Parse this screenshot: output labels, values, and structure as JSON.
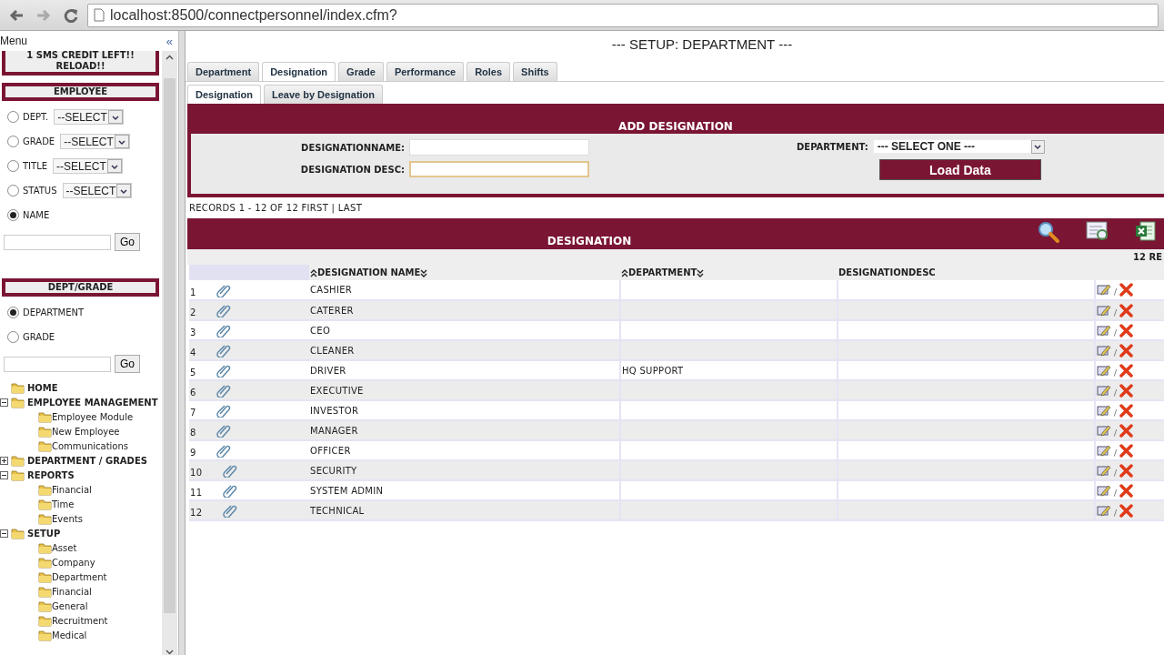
{
  "browser": {
    "url": "localhost:8500/connectpersonnel/index.cfm?"
  },
  "sidebar": {
    "title": "Menu",
    "collapse": "«",
    "sms_notice": "1 SMS CREDIT LEFT!! RELOAD!!",
    "employee_panel": {
      "title": "EMPLOYEE",
      "options": [
        {
          "label": "DEPT.",
          "select": "--SELECT",
          "selected": false
        },
        {
          "label": "GRADE",
          "select": "--SELECT",
          "selected": false
        },
        {
          "label": "TITLE",
          "select": "--SELECT",
          "selected": false
        },
        {
          "label": "STATUS",
          "select": "--SELECT",
          "selected": false
        },
        {
          "label": "NAME",
          "selected": true
        }
      ],
      "button": "Go"
    },
    "dept_panel": {
      "title": "DEPT/GRADE",
      "options": [
        {
          "label": "DEPARTMENT",
          "selected": true
        },
        {
          "label": "GRADE",
          "selected": false
        }
      ],
      "button": "Go"
    },
    "tree": [
      {
        "label": "HOME"
      },
      {
        "label": "EMPLOYEE MANAGEMENT",
        "expanded": true,
        "children": [
          {
            "label": "Employee Module"
          },
          {
            "label": "New Employee"
          },
          {
            "label": "Communications"
          }
        ]
      },
      {
        "label": "DEPARTMENT / GRADES",
        "expanded": false
      },
      {
        "label": "REPORTS",
        "expanded": true,
        "children": [
          {
            "label": "Financial"
          },
          {
            "label": "Time"
          },
          {
            "label": "Events"
          }
        ]
      },
      {
        "label": "SETUP",
        "expanded": true,
        "children": [
          {
            "label": "Asset"
          },
          {
            "label": "Company"
          },
          {
            "label": "Department"
          },
          {
            "label": "Financial"
          },
          {
            "label": "General"
          },
          {
            "label": "Recruitment"
          },
          {
            "label": "Medical"
          }
        ]
      }
    ]
  },
  "main": {
    "title": "--- SETUP: DEPARTMENT ---",
    "tabs": [
      {
        "label": "Department",
        "selected": false
      },
      {
        "label": "Designation",
        "selected": true
      },
      {
        "label": "Grade",
        "selected": false
      },
      {
        "label": "Performance",
        "selected": false
      },
      {
        "label": "Roles",
        "selected": false
      },
      {
        "label": "Shifts",
        "selected": false
      }
    ],
    "subtabs": [
      {
        "label": "Designation",
        "selected": true
      },
      {
        "label": "Leave by Designation",
        "selected": false
      }
    ],
    "add_form": {
      "title": "ADD DESIGNATION",
      "fields": [
        {
          "label": "DESIGNATIONNAME:",
          "focused": false
        },
        {
          "label": "DESIGNATION DESC:",
          "focused": true
        }
      ],
      "department": {
        "label": "DEPARTMENT:",
        "value": "--- SELECT ONE ---"
      },
      "button": "Load Data"
    },
    "records_info": "RECORDS 1 - 12 OF 12 FIRST | LAST",
    "grid": {
      "title": "DESIGNATION",
      "count": "12 RE",
      "columns": [
        {
          "label": "DESIGNATION NAME",
          "sortable": true
        },
        {
          "label": "DEPARTMENT",
          "sortable": true
        },
        {
          "label": "DESIGNATIONDESC",
          "sortable": false
        }
      ],
      "separator": "/",
      "rows": [
        {
          "number": "1",
          "name": "CASHIER"
        },
        {
          "number": "2",
          "name": "CATERER"
        },
        {
          "number": "3",
          "name": "CEO"
        },
        {
          "number": "4",
          "name": "CLEANER"
        },
        {
          "number": "5",
          "name": "DRIVER",
          "department": "HQ SUPPORT"
        },
        {
          "number": "6",
          "name": "EXECUTIVE"
        },
        {
          "number": "7",
          "name": "INVESTOR"
        },
        {
          "number": "8",
          "name": "MANAGER"
        },
        {
          "number": "9",
          "name": "OFFICER"
        },
        {
          "number": "10",
          "name": "SECURITY"
        },
        {
          "number": "11",
          "name": "SYSTEM ADMIN"
        },
        {
          "number": "12",
          "name": "TECHNICAL"
        }
      ]
    }
  }
}
